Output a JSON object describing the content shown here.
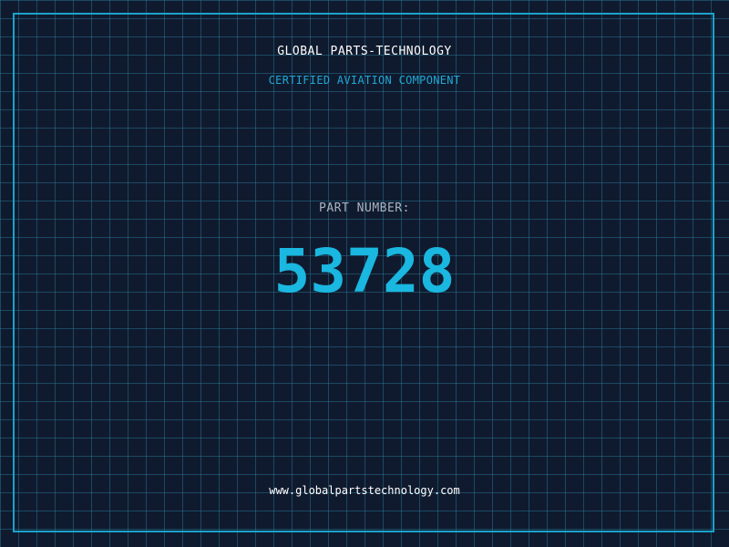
{
  "header": {
    "company": "GLOBAL PARTS-TECHNOLOGY",
    "subtitle": "CERTIFIED AVIATION COMPONENT"
  },
  "part": {
    "label": "PART NUMBER:",
    "number": "53728"
  },
  "footer": {
    "website": "www.globalpartstechnology.com"
  },
  "colors": {
    "background": "#101a2e",
    "grid": "#28829f",
    "accent": "#1ab7e0",
    "border": "#1aa3cc"
  }
}
